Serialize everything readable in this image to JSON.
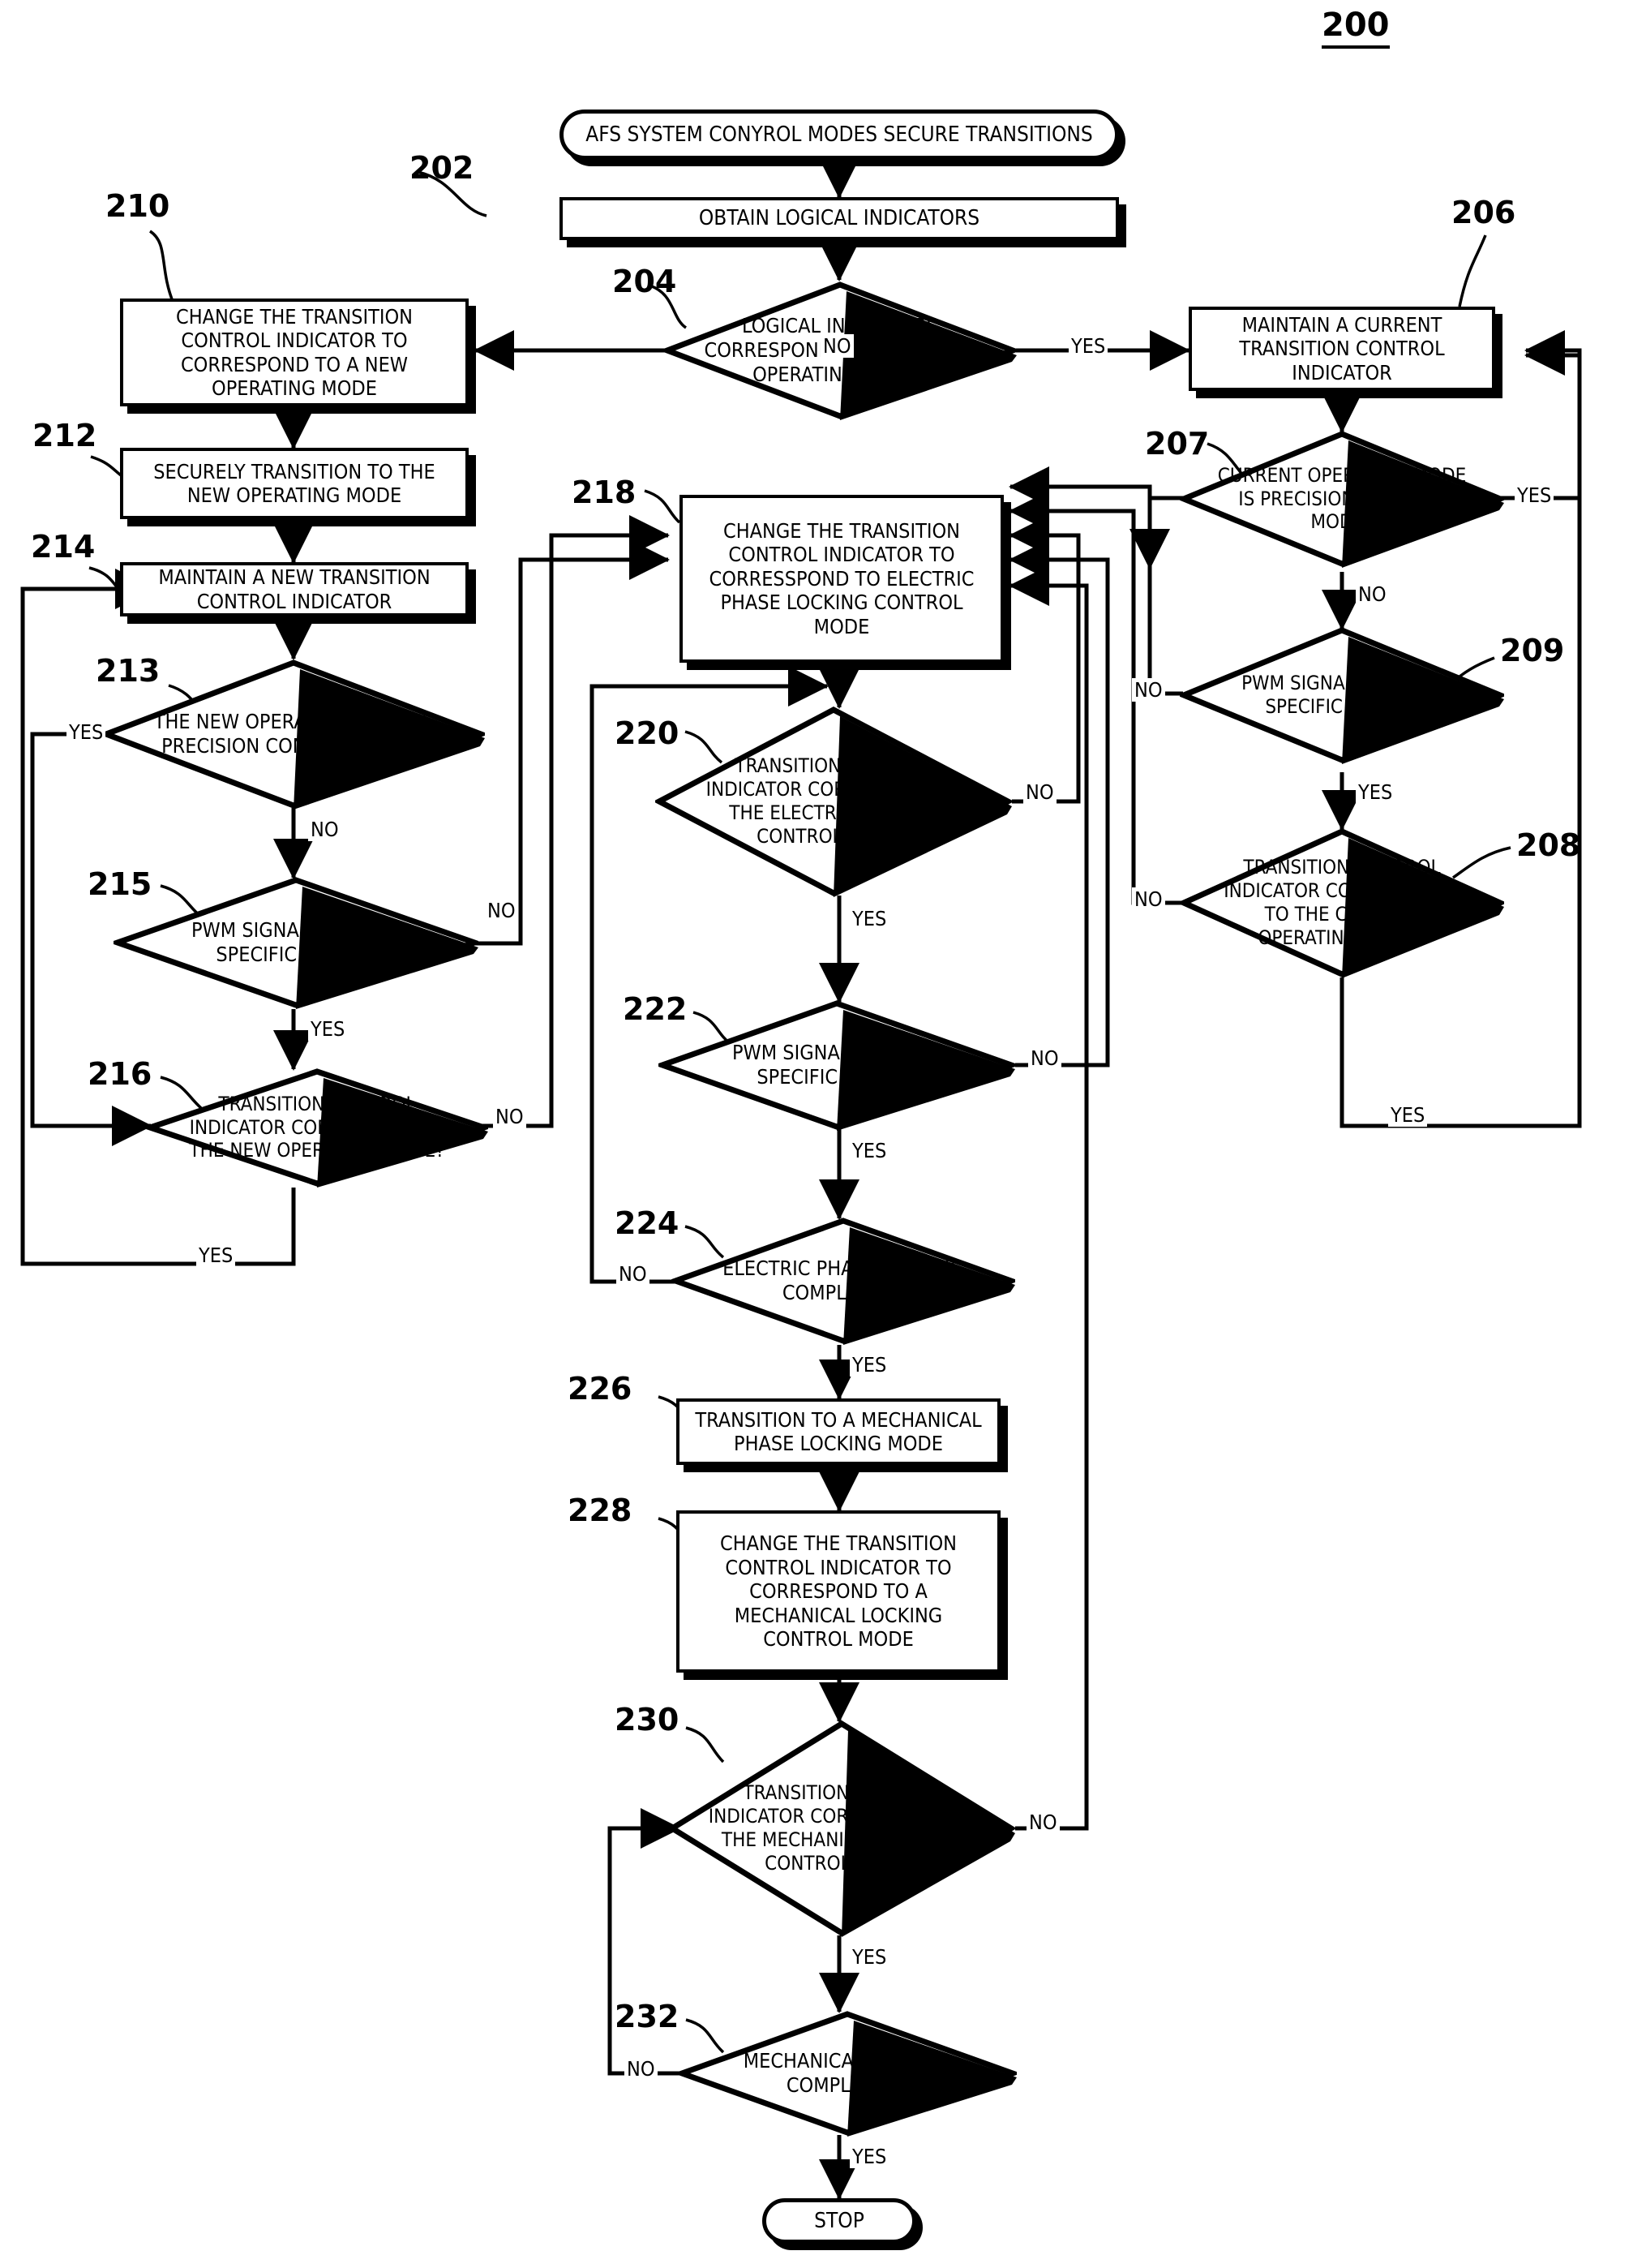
{
  "figure": {
    "number": "200"
  },
  "nodes": {
    "start": {
      "ref": "",
      "text": "AFS SYSTEM CONYROL MODES SECURE TRANSITIONS"
    },
    "n202": {
      "ref": "202",
      "text": "OBTAIN LOGICAL INDICATORS"
    },
    "n204": {
      "ref": "204",
      "text": "LOGICAL INDICATORS CORRESPOND TO A CURRENT OPERATING MODE?"
    },
    "n206": {
      "ref": "206",
      "text": "MAINTAIN A CURRENT TRANSITION CONTROL INDICATOR"
    },
    "n207": {
      "ref": "207",
      "text": "CURRENT OPERATING MODE IS PRECISION CONTROL MODE?"
    },
    "n209": {
      "ref": "209",
      "text": "PWM SIGNAL WITHIN A SPECIFIC RANGE?"
    },
    "n208": {
      "ref": "208",
      "text": "TRANSITION CONTROL INDICATOR CORRESPONDS TO THE CURRENT OPERATING MODE?"
    },
    "n210": {
      "ref": "210",
      "text": "CHANGE THE TRANSITION CONTROL INDICATOR TO CORRESPOND TO A NEW OPERATING MODE"
    },
    "n212": {
      "ref": "212",
      "text": "SECURELY TRANSITION TO THE NEW OPERATING MODE"
    },
    "n214": {
      "ref": "214",
      "text": "MAINTAIN A NEW TRANSITION CONTROL INDICATOR"
    },
    "n213": {
      "ref": "213",
      "text": "THE NEW OPERATING MODE IS PRECISION CONTROL MODE?"
    },
    "n215": {
      "ref": "215",
      "text": "PWM SIGNAL WITHIN A SPECIFIC RANGE?"
    },
    "n216": {
      "ref": "216",
      "text": "TRANSITION CONTROL INDICATOR CORRESPOND TO THE NEW OPERATING MODE?"
    },
    "n218": {
      "ref": "218",
      "text": "CHANGE THE TRANSITION CONTROL INDICATOR TO CORRESSPOND TO ELECTRIC PHASE LOCKING CONTROL MODE"
    },
    "n220": {
      "ref": "220",
      "text": "TRANSITION CONTROL INDICATOR CORRESPOND TO THE ELECTRIC LOCKING CONTROL MODE?"
    },
    "n222": {
      "ref": "222",
      "text": "PWM SIGNAL WITHIN A SPECIFIC RANGE?"
    },
    "n224": {
      "ref": "224",
      "text": "ELECTRIC PHASE LOCKING COMPLETED?"
    },
    "n226": {
      "ref": "226",
      "text": "TRANSITION TO A MECHANICAL PHASE LOCKING MODE"
    },
    "n228": {
      "ref": "228",
      "text": "CHANGE THE TRANSITION CONTROL INDICATOR TO CORRESPOND TO A MECHANICAL LOCKING CONTROL MODE"
    },
    "n230": {
      "ref": "230",
      "text": "TRANSITION CONTROL INDICATOR CORRESPONDS TO THE MECHANICAL LOCKING CONTROL MODE?"
    },
    "n232": {
      "ref": "232",
      "text": "MECHANICAL LOCKING COMPLETED?"
    },
    "stop": {
      "ref": "",
      "text": "STOP"
    }
  },
  "edge_labels": {
    "e204_no": "NO",
    "e204_yes": "YES",
    "e207_yes": "YES",
    "e207_no": "NO",
    "e209_no": "NO",
    "e209_yes": "YES",
    "e208_no": "NO",
    "e208_yes": "YES",
    "e213_yes": "YES",
    "e213_no": "NO",
    "e215_no": "NO",
    "e215_yes": "YES",
    "e216_no": "NO",
    "e216_yes": "YES",
    "e220_no": "NO",
    "e220_yes": "YES",
    "e222_no": "NO",
    "e222_yes": "YES",
    "e224_no": "NO",
    "e224_yes": "YES",
    "e230_no": "NO",
    "e230_yes": "YES",
    "e232_no": "NO",
    "e232_yes": "YES"
  }
}
